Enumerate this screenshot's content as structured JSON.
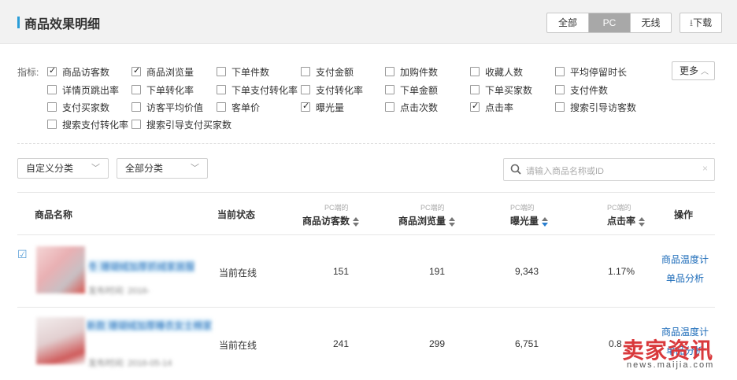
{
  "header": {
    "title": "商品效果明细",
    "segments": [
      "全部",
      "PC",
      "无线"
    ],
    "active_segment": "PC",
    "download": "下载"
  },
  "metrics": {
    "label": "指标:",
    "more": "更多",
    "items": [
      {
        "label": "商品访客数",
        "checked": true
      },
      {
        "label": "商品浏览量",
        "checked": true
      },
      {
        "label": "下单件数",
        "checked": false
      },
      {
        "label": "支付金额",
        "checked": false
      },
      {
        "label": "加购件数",
        "checked": false
      },
      {
        "label": "收藏人数",
        "checked": false
      },
      {
        "label": "平均停留时长",
        "checked": false
      },
      {
        "label": "详情页跳出率",
        "checked": false
      },
      {
        "label": "下单转化率",
        "checked": false
      },
      {
        "label": "下单支付转化率",
        "checked": false
      },
      {
        "label": "支付转化率",
        "checked": false
      },
      {
        "label": "下单金额",
        "checked": false
      },
      {
        "label": "下单买家数",
        "checked": false
      },
      {
        "label": "支付件数",
        "checked": false
      },
      {
        "label": "支付买家数",
        "checked": false
      },
      {
        "label": "访客平均价值",
        "checked": false
      },
      {
        "label": "客单价",
        "checked": false
      },
      {
        "label": "曝光量",
        "checked": true
      },
      {
        "label": "点击次数",
        "checked": false
      },
      {
        "label": "点击率",
        "checked": true
      },
      {
        "label": "搜索引导访客数",
        "checked": false
      },
      {
        "label": "搜索支付转化率",
        "checked": false
      },
      {
        "label": "搜索引导支付买家数",
        "checked": false
      }
    ]
  },
  "filters": {
    "custom_category": "自定义分类",
    "all_category": "全部分类",
    "search_placeholder": "请输入商品名称或ID"
  },
  "table": {
    "headers": {
      "name": "商品名称",
      "status": "当前状态",
      "prefix": "PC端的",
      "visitors": "商品访客数",
      "views": "商品浏览量",
      "exposure": "曝光量",
      "ctr": "点击率",
      "action": "操作"
    },
    "rows": [
      {
        "title": "冬 珊瑚绒加厚抓绒家居服",
        "date": "发布时间: 2016-",
        "status": "当前在线",
        "visitors": "151",
        "views": "191",
        "exposure": "9,343",
        "ctr": "1.17%",
        "action1": "商品温度计",
        "action2": "单品分析"
      },
      {
        "title": "新款 珊瑚绒加厚睡衣女士棉家",
        "date": "发布时间: 2016-05-14",
        "status": "当前在线",
        "visitors": "241",
        "views": "299",
        "exposure": "6,751",
        "ctr": "0.8",
        "action1": "商品温度计",
        "action2": "单品分析"
      }
    ]
  },
  "watermark": {
    "text": "卖家资讯",
    "url": "news.maijia.com"
  }
}
